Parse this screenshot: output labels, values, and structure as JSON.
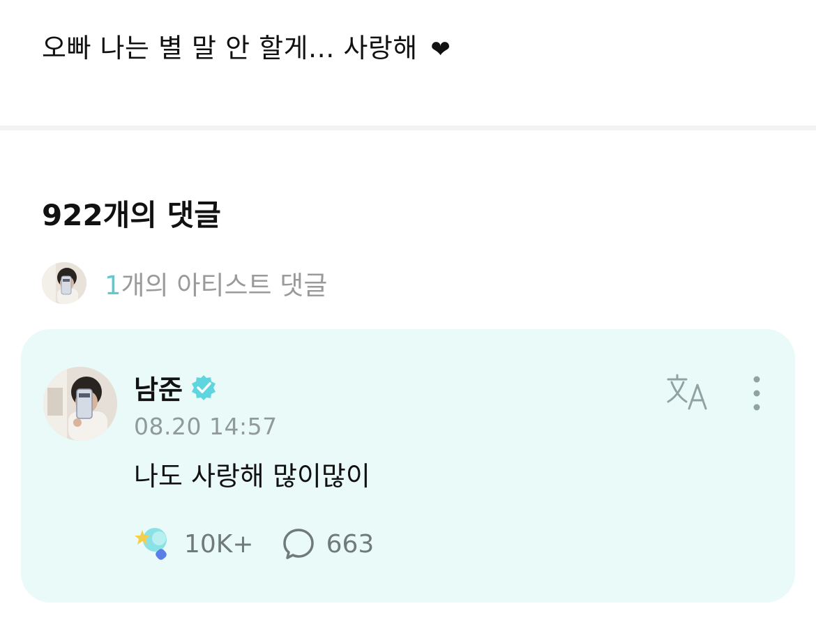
{
  "post": {
    "text": "오빠 나는 별 말 안 할게... 사랑해",
    "heart": "❤"
  },
  "comments": {
    "title": "922개의 댓글",
    "artist_count": "1",
    "artist_label": "개의 아티스트 댓글"
  },
  "artist_comment": {
    "author": "남준",
    "timestamp": "08.20 14:57",
    "body": "나도 사랑해 많이많이",
    "likes": "10K+",
    "replies": "663"
  },
  "colors": {
    "accent": "#5fc9d0",
    "card_bg": "#eafaf8",
    "muted_text": "#8f9a99"
  },
  "icons": {
    "verified": "verified-badge-icon",
    "translate": "translate-icon",
    "more": "more-vertical-icon",
    "like": "light-stick-like-icon",
    "reply": "comment-bubble-icon"
  }
}
